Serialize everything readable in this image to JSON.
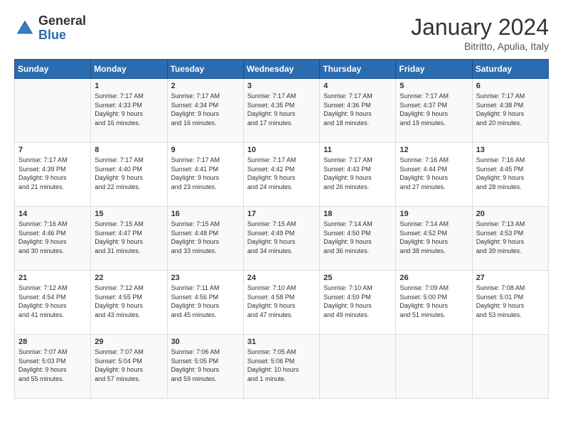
{
  "header": {
    "logo": {
      "general": "General",
      "blue": "Blue"
    },
    "title": "January 2024",
    "subtitle": "Bitritto, Apulia, Italy"
  },
  "weekdays": [
    "Sunday",
    "Monday",
    "Tuesday",
    "Wednesday",
    "Thursday",
    "Friday",
    "Saturday"
  ],
  "weeks": [
    [
      {
        "day": "",
        "info": ""
      },
      {
        "day": "1",
        "info": "Sunrise: 7:17 AM\nSunset: 4:33 PM\nDaylight: 9 hours\nand 16 minutes."
      },
      {
        "day": "2",
        "info": "Sunrise: 7:17 AM\nSunset: 4:34 PM\nDaylight: 9 hours\nand 16 minutes."
      },
      {
        "day": "3",
        "info": "Sunrise: 7:17 AM\nSunset: 4:35 PM\nDaylight: 9 hours\nand 17 minutes."
      },
      {
        "day": "4",
        "info": "Sunrise: 7:17 AM\nSunset: 4:36 PM\nDaylight: 9 hours\nand 18 minutes."
      },
      {
        "day": "5",
        "info": "Sunrise: 7:17 AM\nSunset: 4:37 PM\nDaylight: 9 hours\nand 19 minutes."
      },
      {
        "day": "6",
        "info": "Sunrise: 7:17 AM\nSunset: 4:38 PM\nDaylight: 9 hours\nand 20 minutes."
      }
    ],
    [
      {
        "day": "7",
        "info": "Sunrise: 7:17 AM\nSunset: 4:39 PM\nDaylight: 9 hours\nand 21 minutes."
      },
      {
        "day": "8",
        "info": "Sunrise: 7:17 AM\nSunset: 4:40 PM\nDaylight: 9 hours\nand 22 minutes."
      },
      {
        "day": "9",
        "info": "Sunrise: 7:17 AM\nSunset: 4:41 PM\nDaylight: 9 hours\nand 23 minutes."
      },
      {
        "day": "10",
        "info": "Sunrise: 7:17 AM\nSunset: 4:42 PM\nDaylight: 9 hours\nand 24 minutes."
      },
      {
        "day": "11",
        "info": "Sunrise: 7:17 AM\nSunset: 4:43 PM\nDaylight: 9 hours\nand 26 minutes."
      },
      {
        "day": "12",
        "info": "Sunrise: 7:16 AM\nSunset: 4:44 PM\nDaylight: 9 hours\nand 27 minutes."
      },
      {
        "day": "13",
        "info": "Sunrise: 7:16 AM\nSunset: 4:45 PM\nDaylight: 9 hours\nand 28 minutes."
      }
    ],
    [
      {
        "day": "14",
        "info": "Sunrise: 7:16 AM\nSunset: 4:46 PM\nDaylight: 9 hours\nand 30 minutes."
      },
      {
        "day": "15",
        "info": "Sunrise: 7:15 AM\nSunset: 4:47 PM\nDaylight: 9 hours\nand 31 minutes."
      },
      {
        "day": "16",
        "info": "Sunrise: 7:15 AM\nSunset: 4:48 PM\nDaylight: 9 hours\nand 33 minutes."
      },
      {
        "day": "17",
        "info": "Sunrise: 7:15 AM\nSunset: 4:49 PM\nDaylight: 9 hours\nand 34 minutes."
      },
      {
        "day": "18",
        "info": "Sunrise: 7:14 AM\nSunset: 4:50 PM\nDaylight: 9 hours\nand 36 minutes."
      },
      {
        "day": "19",
        "info": "Sunrise: 7:14 AM\nSunset: 4:52 PM\nDaylight: 9 hours\nand 38 minutes."
      },
      {
        "day": "20",
        "info": "Sunrise: 7:13 AM\nSunset: 4:53 PM\nDaylight: 9 hours\nand 39 minutes."
      }
    ],
    [
      {
        "day": "21",
        "info": "Sunrise: 7:12 AM\nSunset: 4:54 PM\nDaylight: 9 hours\nand 41 minutes."
      },
      {
        "day": "22",
        "info": "Sunrise: 7:12 AM\nSunset: 4:55 PM\nDaylight: 9 hours\nand 43 minutes."
      },
      {
        "day": "23",
        "info": "Sunrise: 7:11 AM\nSunset: 4:56 PM\nDaylight: 9 hours\nand 45 minutes."
      },
      {
        "day": "24",
        "info": "Sunrise: 7:10 AM\nSunset: 4:58 PM\nDaylight: 9 hours\nand 47 minutes."
      },
      {
        "day": "25",
        "info": "Sunrise: 7:10 AM\nSunset: 4:59 PM\nDaylight: 9 hours\nand 49 minutes."
      },
      {
        "day": "26",
        "info": "Sunrise: 7:09 AM\nSunset: 5:00 PM\nDaylight: 9 hours\nand 51 minutes."
      },
      {
        "day": "27",
        "info": "Sunrise: 7:08 AM\nSunset: 5:01 PM\nDaylight: 9 hours\nand 53 minutes."
      }
    ],
    [
      {
        "day": "28",
        "info": "Sunrise: 7:07 AM\nSunset: 5:03 PM\nDaylight: 9 hours\nand 55 minutes."
      },
      {
        "day": "29",
        "info": "Sunrise: 7:07 AM\nSunset: 5:04 PM\nDaylight: 9 hours\nand 57 minutes."
      },
      {
        "day": "30",
        "info": "Sunrise: 7:06 AM\nSunset: 5:05 PM\nDaylight: 9 hours\nand 59 minutes."
      },
      {
        "day": "31",
        "info": "Sunrise: 7:05 AM\nSunset: 5:06 PM\nDaylight: 10 hours\nand 1 minute."
      },
      {
        "day": "",
        "info": ""
      },
      {
        "day": "",
        "info": ""
      },
      {
        "day": "",
        "info": ""
      }
    ]
  ]
}
